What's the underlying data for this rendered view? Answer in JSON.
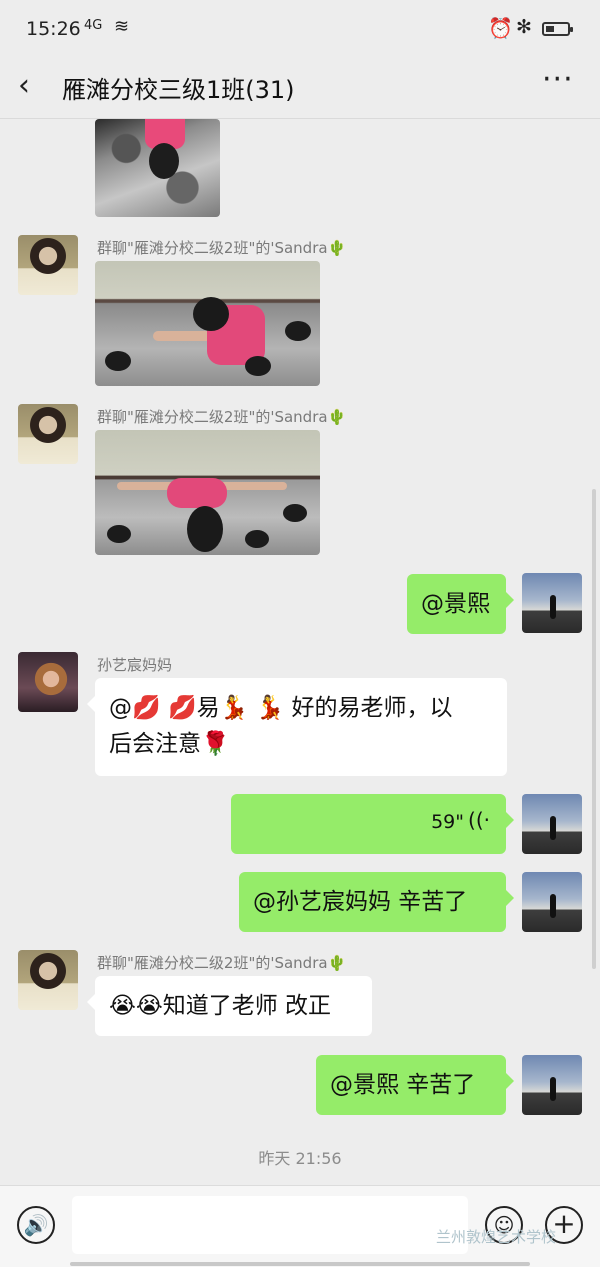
{
  "status_bar": {
    "time": "15:26",
    "signal": "4G",
    "wifi_icon": "wifi-icon",
    "alarm_icon": "alarm-icon",
    "bluetooth_icon": "bluetooth-icon",
    "battery_icon": "battery-icon",
    "battery_level": 0.3
  },
  "header": {
    "back_icon": "‹",
    "title": "雁滩分校三级1班(31)",
    "more_icon": "···"
  },
  "messages": [
    {
      "sender": "群聊\"雁滩分校二级2班\"的'Sandra🌵"
    },
    {
      "sender": "群聊\"雁滩分校二级2班\"的'Sandra🌵"
    },
    {
      "text": "@景熙"
    },
    {
      "sender": "孙艺宸妈妈",
      "text_line1": "@💋 💋易💃 💃 好的易老师，以",
      "text_line2": "后会注意🌹"
    },
    {
      "voice_duration": "59\"",
      "voice_icon": "voice-wave-icon"
    },
    {
      "text": "@孙艺宸妈妈  辛苦了"
    },
    {
      "sender": "群聊\"雁滩分校二级2班\"的'Sandra🌵",
      "text": "😭😭知道了老师 改正"
    },
    {
      "text": "@景熙  辛苦了"
    }
  ],
  "timestamp": "昨天 21:56",
  "input_bar": {
    "voice_button": "🔊",
    "emoji_button": "☺",
    "plus_button": "+",
    "input_value": ""
  },
  "watermark": "兰州敦煌艺术学校"
}
